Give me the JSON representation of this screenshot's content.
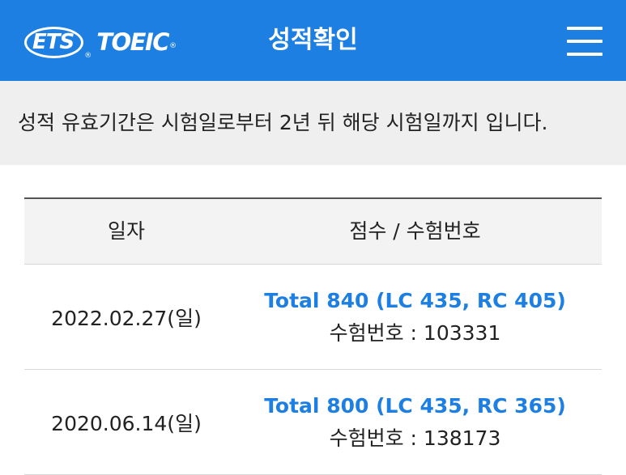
{
  "header": {
    "logo_ets": "ETS",
    "logo_toeic": "TOEIC",
    "registered_mark": "®",
    "title": "성적확인",
    "menu_icon": "hamburger-menu-icon",
    "background_color": "#1d7fe2"
  },
  "notice": {
    "text": "성적 유효기간은 시험일로부터 2년 뒤 해당 시험일까지 입니다."
  },
  "table": {
    "headers": {
      "date": "일자",
      "score": "점수 / 수험번호"
    },
    "rows": [
      {
        "date": "2022.02.27(일)",
        "total": "Total 840 (LC 435, RC 405)",
        "exam_no": "수험번호 : 103331"
      },
      {
        "date": "2020.06.14(일)",
        "total": "Total 800 (LC 435, RC 365)",
        "exam_no": "수험번호 : 138173"
      }
    ],
    "score_link_color": "#1d7fe2"
  }
}
